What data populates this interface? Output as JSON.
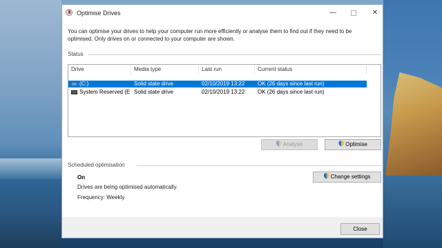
{
  "window": {
    "title": "Optimise Drives",
    "controls": {
      "minimize": "—",
      "close": "✕"
    }
  },
  "description": "You can optimise your drives to help your computer run more efficiently or analyse them to find out if they need to be optimised. Only drives on or connected to your computer are shown.",
  "status": {
    "label": "Status",
    "columns": [
      "Drive",
      "Media type",
      "Last run",
      "Current status"
    ],
    "drives": [
      {
        "drive": "(C:)",
        "media_type": "Solid state drive",
        "last_run": "02/10/2019 13:22",
        "current_status": "OK (26 days since last run)",
        "icon": "ssd-drive-icon",
        "selected": true
      },
      {
        "drive": "System Reserved (E:)",
        "media_type": "Solid state drive",
        "last_run": "02/10/2019 13:22",
        "current_status": "OK (26 days since last run)",
        "icon": "drive-icon",
        "selected": false
      }
    ],
    "analyse_label": "Analyse",
    "optimise_label": "Optimise"
  },
  "scheduled": {
    "label": "Scheduled optimisation",
    "status": "On",
    "description": "Drives are being optimised automatically.",
    "frequency": "Frequency: Weekly",
    "change_settings_label": "Change settings"
  },
  "footer": {
    "close_label": "Close"
  },
  "colors": {
    "selection": "#0078d7",
    "window_border": "#8aa7c4"
  }
}
